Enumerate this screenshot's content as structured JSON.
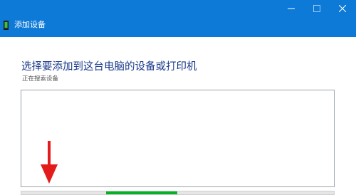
{
  "window": {
    "title": "添加设备",
    "icon": "add-device-icon",
    "controls": [
      "minimize-icon",
      "maximize-icon",
      "close-icon"
    ]
  },
  "main": {
    "heading": "选择要添加到这台电脑的设备或打印机",
    "status": "正在搜索设备",
    "device_list": []
  },
  "progress": {
    "indeterminate": true,
    "segment_start_fraction": 0.27,
    "segment_end_fraction": 0.5,
    "color": "#07b024"
  },
  "colors": {
    "titlebar": "#0e7ad8",
    "heading": "#1a3a8a",
    "annotation_arrow": "#e31b1b"
  }
}
